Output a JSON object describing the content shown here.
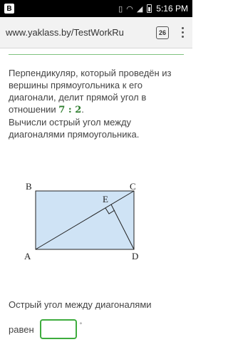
{
  "status_bar": {
    "app_badge": "B",
    "time": "5:16 PM"
  },
  "browser": {
    "url": "www.yaklass.by/TestWorkRu",
    "tab_count": "26"
  },
  "problem": {
    "line1": "Перпендикуляр, который проведён из",
    "line2": "вершины прямоугольника к его",
    "line3": "диагонали, делит прямой угол в",
    "line4_prefix": "отношении",
    "ratio": "7 : 2",
    "line4_suffix": ".",
    "line5": "Вычисли острый угол между",
    "line6": "диагоналями прямоугольника."
  },
  "figure": {
    "labels": {
      "A": "A",
      "B": "B",
      "C": "C",
      "D": "D",
      "E": "E"
    },
    "colors": {
      "fill": "#cfe3f5",
      "stroke": "#222222"
    }
  },
  "answer": {
    "line1": "Острый угол между диагоналями",
    "label": "равен",
    "value": "",
    "unit": "°"
  }
}
